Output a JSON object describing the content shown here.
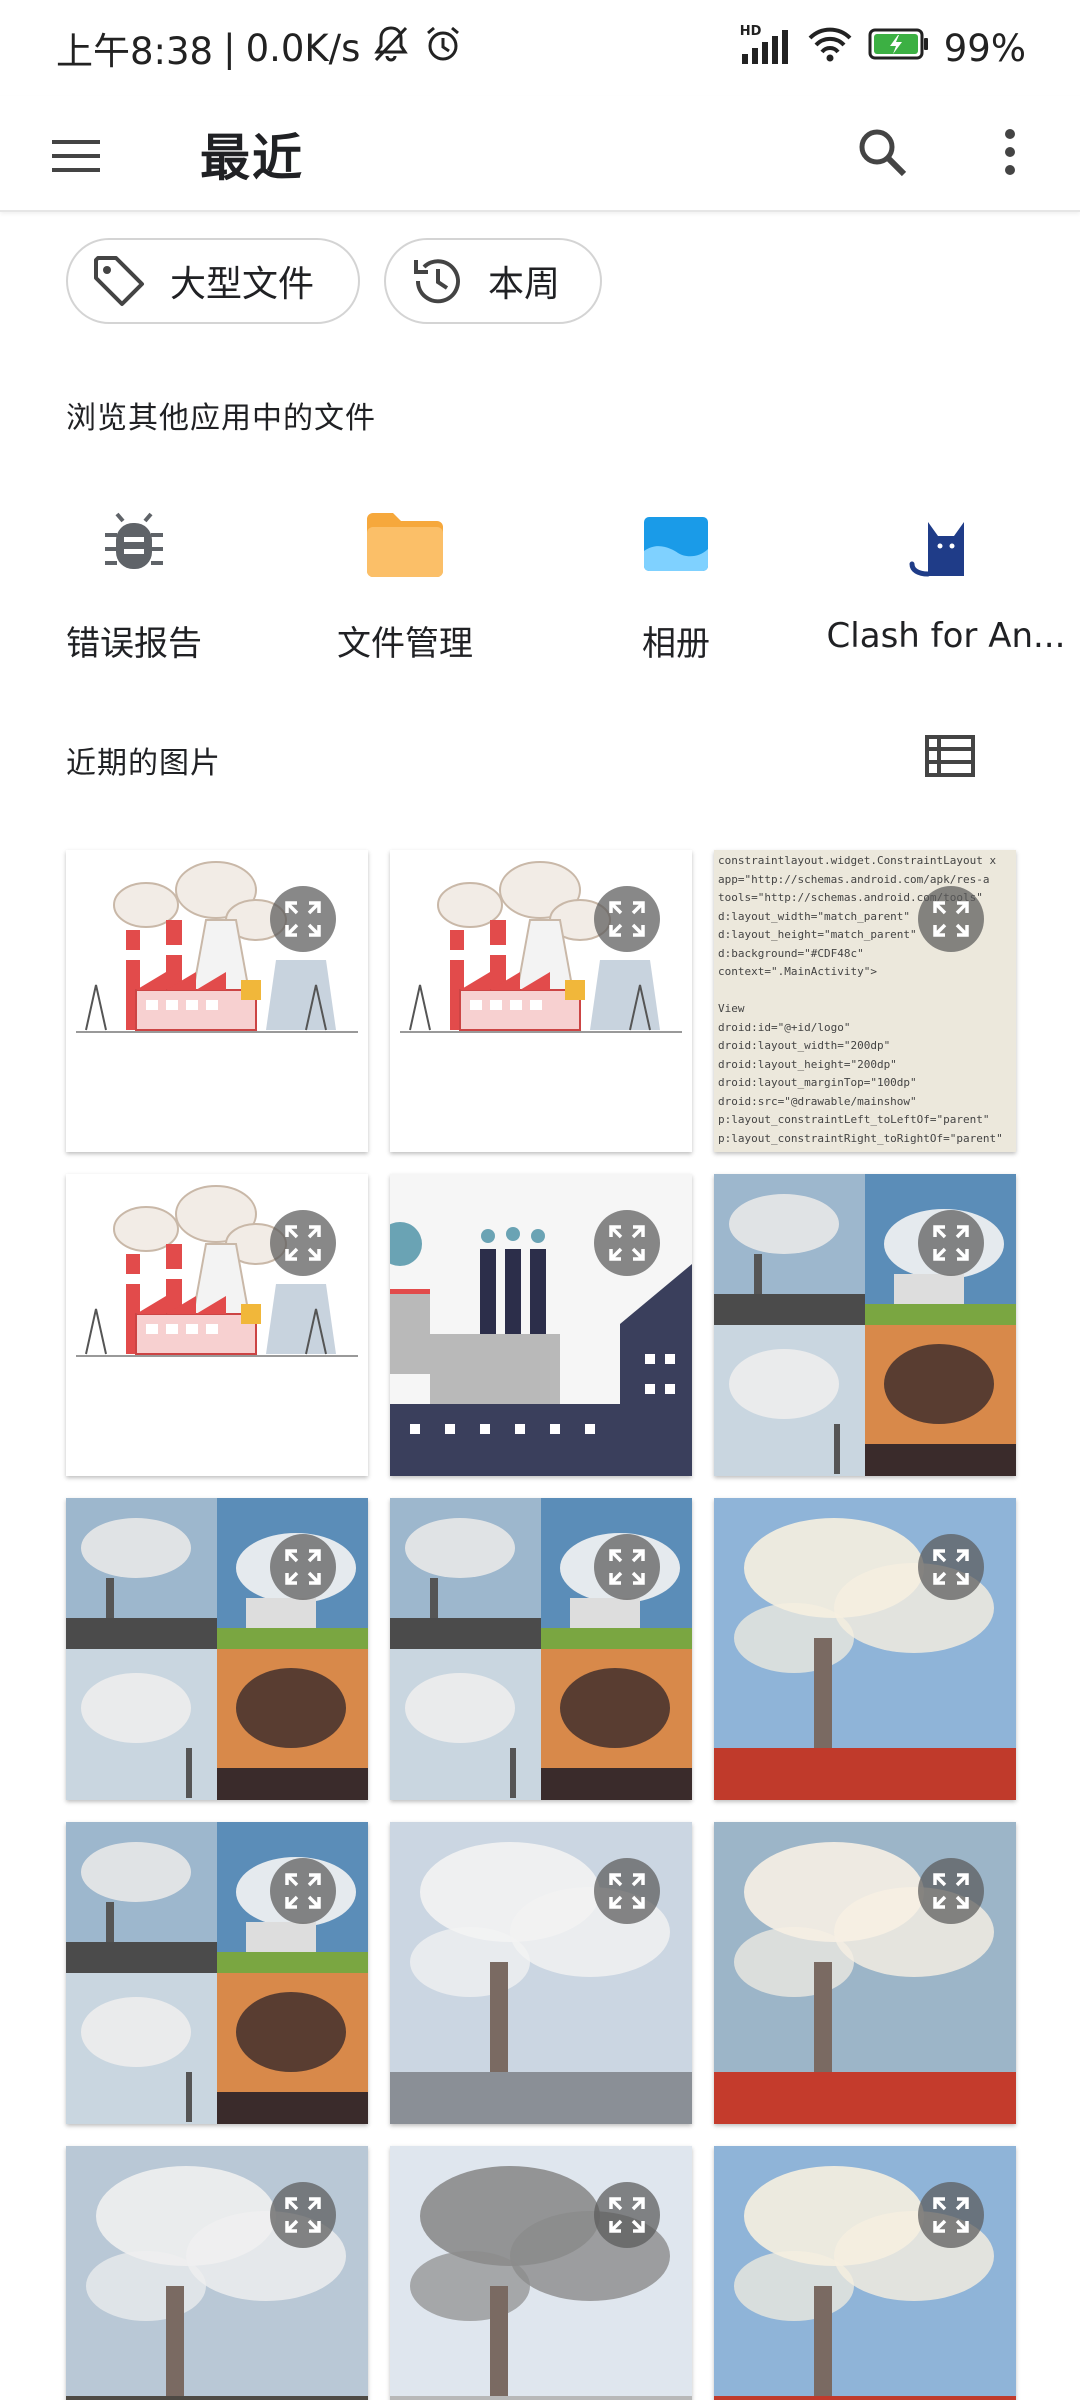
{
  "status_bar": {
    "time": "上午8:38",
    "network_speed": "0.0K/s",
    "network_badge": "HD",
    "battery": "99%"
  },
  "app_bar": {
    "title": "最近",
    "menu_icon": "hamburger-menu-icon",
    "search_icon": "search-icon",
    "more_icon": "more-vertical-icon"
  },
  "chips": [
    {
      "label": "大型文件",
      "icon": "tag-icon"
    },
    {
      "label": "本周",
      "icon": "history-icon"
    }
  ],
  "browse_section": {
    "title": "浏览其他应用中的文件",
    "apps": [
      {
        "label": "错误报告",
        "icon": "bug-icon"
      },
      {
        "label": "文件管理",
        "icon": "folder-icon"
      },
      {
        "label": "相册",
        "icon": "gallery-icon"
      },
      {
        "label": "Clash for An...",
        "icon": "cat-icon"
      }
    ]
  },
  "recent_images": {
    "title": "近期的图片",
    "view_icon": "list-view-icon",
    "thumbnails": [
      {
        "kind": "factory-illustration"
      },
      {
        "kind": "factory-illustration"
      },
      {
        "kind": "code-photo"
      },
      {
        "kind": "factory-illustration"
      },
      {
        "kind": "flat-factory"
      },
      {
        "kind": "smoke-collage"
      },
      {
        "kind": "smoke-collage"
      },
      {
        "kind": "smoke-collage"
      },
      {
        "kind": "smoke-photo"
      },
      {
        "kind": "smoke-collage"
      },
      {
        "kind": "smoke-photo"
      },
      {
        "kind": "smoke-photo"
      },
      {
        "kind": "smoke-photo"
      },
      {
        "kind": "smoke-photo"
      },
      {
        "kind": "smoke-photo"
      }
    ],
    "code_lines": [
      "constraintlayout.widget.ConstraintLayout x",
      "app=\"http://schemas.android.com/apk/res-a",
      "tools=\"http://schemas.android.com/tools\"",
      "d:layout_width=\"match_parent\"",
      "d:layout_height=\"match_parent\"",
      "d:background=\"#CDF48c\"",
      "context=\".MainActivity\">",
      "",
      "View",
      "droid:id=\"@+id/logo\"",
      "droid:layout_width=\"200dp\"",
      "droid:layout_height=\"200dp\"",
      "droid:layout_marginTop=\"100dp\"",
      "droid:src=\"@drawable/mainshow\"",
      "p:layout_constraintLeft_toLeftOf=\"parent\"",
      "p:layout_constraintRight_toRightOf=\"parent\""
    ]
  },
  "colors": {
    "accent_battery": "#3cb043",
    "folder": "#f9b55a",
    "gallery": "#1a9be8",
    "clash_cat": "#1f3c88",
    "icon_gray": "#5f6368"
  }
}
